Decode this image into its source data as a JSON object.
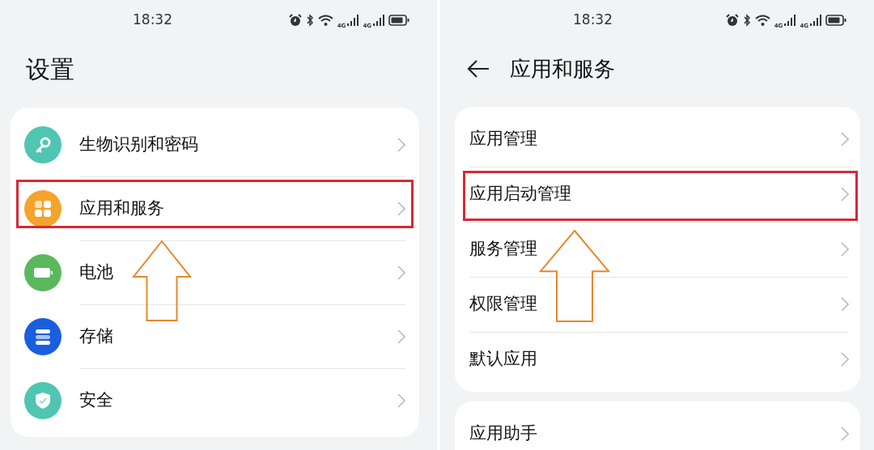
{
  "screens": [
    {
      "status_bar": {
        "time": "18:32",
        "network_labels": [
          "4G",
          "4G"
        ]
      },
      "header": {
        "back": false,
        "title": "设置"
      },
      "groups": [
        {
          "items": [
            {
              "label": "生物识别和密码",
              "kind": "key",
              "color": "#4fc5b2",
              "highlighted": false
            },
            {
              "label": "应用和服务",
              "kind": "apps",
              "color": "#f4a42c",
              "highlighted": true
            },
            {
              "label": "电池",
              "kind": "battery",
              "color": "#5cb85c",
              "highlighted": false
            },
            {
              "label": "存储",
              "kind": "storage",
              "color": "#1a5ee0",
              "highlighted": false
            },
            {
              "label": "安全",
              "kind": "shield",
              "color": "#4fc5b2",
              "highlighted": false
            }
          ]
        }
      ]
    },
    {
      "status_bar": {
        "time": "18:32",
        "network_labels": [
          "4G",
          "4G"
        ]
      },
      "header": {
        "back": true,
        "title": "应用和服务"
      },
      "groups": [
        {
          "items": [
            {
              "label": "应用管理",
              "highlighted": false
            },
            {
              "label": "应用启动管理",
              "highlighted": true
            },
            {
              "label": "服务管理",
              "highlighted": false
            },
            {
              "label": "权限管理",
              "highlighted": false
            },
            {
              "label": "默认应用",
              "highlighted": false
            }
          ]
        },
        {
          "items": [
            {
              "label": "应用助手",
              "highlighted": false
            }
          ]
        }
      ]
    }
  ]
}
